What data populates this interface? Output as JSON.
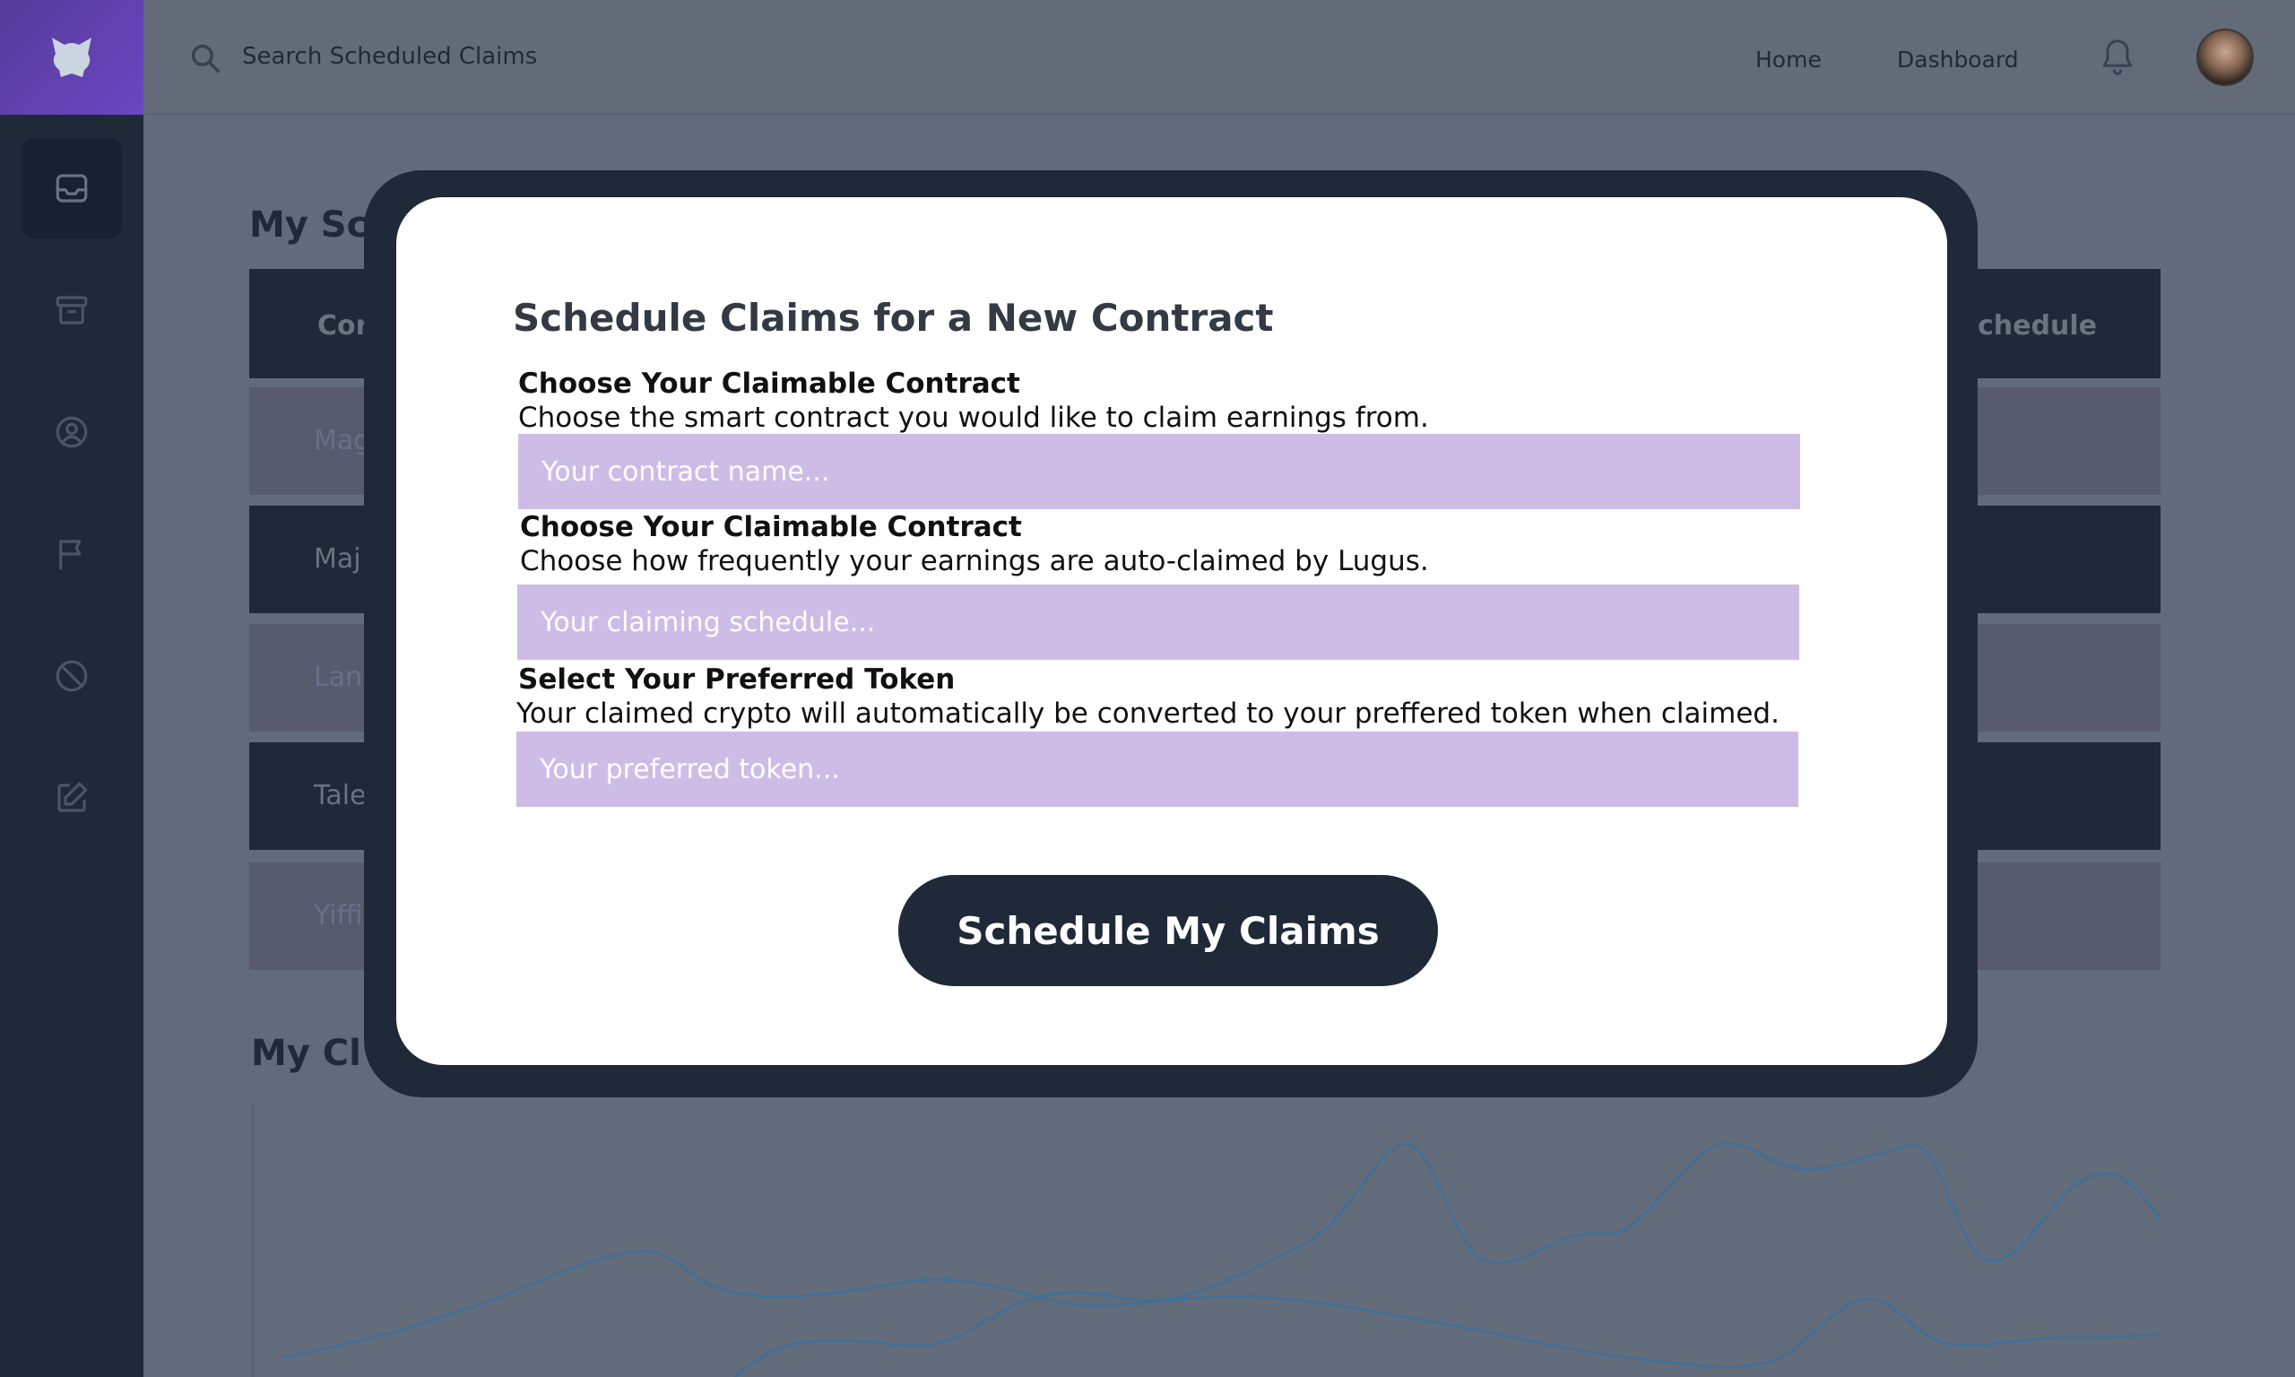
{
  "topbar": {
    "search_placeholder": "Search Scheduled Claims",
    "nav": [
      "Home",
      "Dashboard"
    ]
  },
  "sidebar": {
    "items": [
      {
        "icon": "inbox-icon",
        "active": true
      },
      {
        "icon": "archive-icon",
        "active": false
      },
      {
        "icon": "user-circle-icon",
        "active": false
      },
      {
        "icon": "flag-icon",
        "active": false
      },
      {
        "icon": "ban-icon",
        "active": false
      },
      {
        "icon": "edit-icon",
        "active": false
      }
    ]
  },
  "background": {
    "section_title": "My Sc",
    "table": {
      "header_left": "Cor",
      "header_right": "chedule",
      "rows": [
        "Mag",
        "Maj",
        "Lan",
        "Tale",
        "Yiffi"
      ]
    },
    "chart_title": "My Cl"
  },
  "modal": {
    "title": "Schedule Claims for a New Contract",
    "fields": [
      {
        "label": "Choose Your Claimable Contract",
        "help": "Choose the smart contract you would like to claim earnings from.",
        "placeholder": "Your contract name..."
      },
      {
        "label": "Choose Your Claimable Contract",
        "help": "Choose how frequently your earnings are auto-claimed by Lugus.",
        "placeholder": "Your claiming schedule..."
      },
      {
        "label": "Select Your Preferred Token",
        "help": "Your claimed crypto will automatically be converted to your preffered token when claimed.",
        "placeholder": "Your preferred token..."
      }
    ],
    "submit_label": "Schedule My Claims"
  },
  "colors": {
    "navy": "#1f2937",
    "input_bg": "#cdbde6",
    "logo_purple": "#6b46c1"
  }
}
